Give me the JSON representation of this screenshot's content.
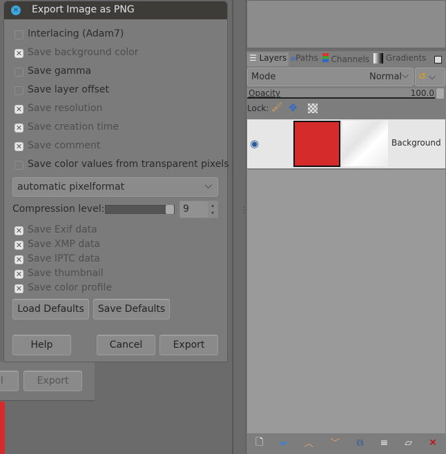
{
  "dialog": {
    "title": "Export Image as PNG",
    "options": [
      {
        "label": "Interlacing (Adam7)",
        "checked": false,
        "enabled": true
      },
      {
        "label": "Save background color",
        "checked": true,
        "enabled": false
      },
      {
        "label": "Save gamma",
        "checked": false,
        "enabled": true
      },
      {
        "label": "Save layer offset",
        "checked": false,
        "enabled": true
      },
      {
        "label": "Save resolution",
        "checked": true,
        "enabled": false
      },
      {
        "label": "Save creation time",
        "checked": true,
        "enabled": false
      },
      {
        "label": "Save comment",
        "checked": true,
        "enabled": false
      },
      {
        "label": "Save color values from transparent pixels",
        "checked": false,
        "enabled": true
      }
    ],
    "pixelformat": "automatic pixelformat",
    "compression_label": "Compression level:",
    "compression_value": "9",
    "compression_fraction": 1.0,
    "metadata": [
      {
        "label": "Save Exif data",
        "checked": true
      },
      {
        "label": "Save XMP data",
        "checked": true
      },
      {
        "label": "Save IPTC data",
        "checked": true
      },
      {
        "label": "Save thumbnail",
        "checked": true
      },
      {
        "label": "Save color profile",
        "checked": true
      }
    ],
    "load_defaults": "Load Defaults",
    "save_defaults": "Save Defaults",
    "help": "Help",
    "cancel": "Cancel",
    "export": "Export"
  },
  "behind": {
    "cancel_partial": "el",
    "export": "Export"
  },
  "layers": {
    "tabs": [
      "Layers",
      "Paths",
      "Channels",
      "Gradients"
    ],
    "mode_label": "Mode",
    "mode_value": "Normal",
    "opacity_label": "Opacity",
    "opacity_value": "100.0",
    "lock_label": "Lock:",
    "layer_name": "Background",
    "layer_color": "#d62b2b"
  }
}
